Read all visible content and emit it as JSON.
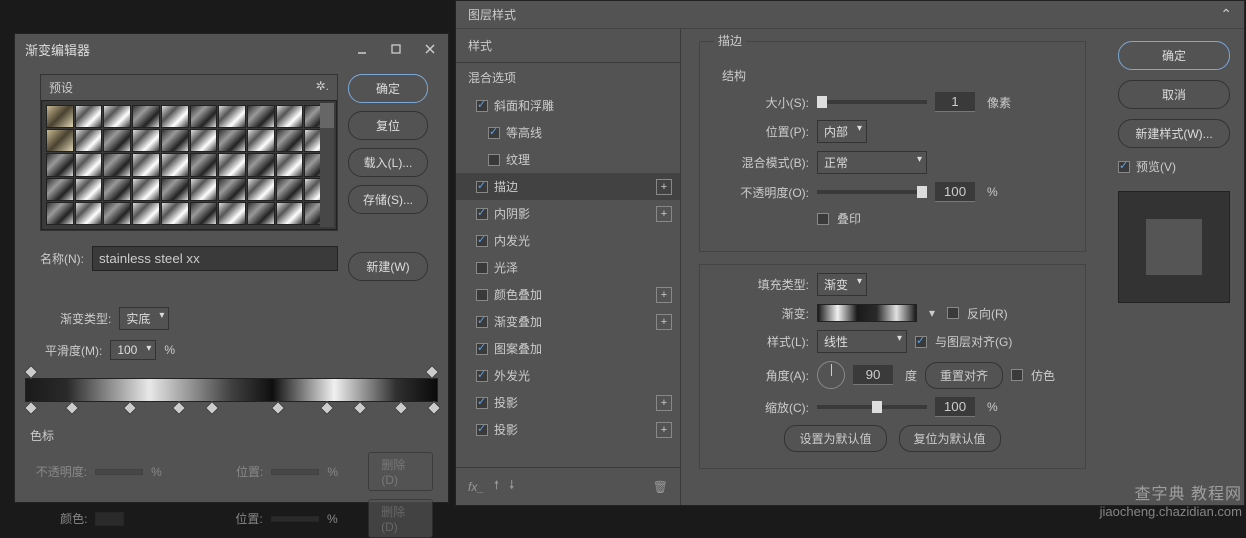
{
  "gradient_editor": {
    "title": "渐变编辑器",
    "presets_label": "预设",
    "ok": "确定",
    "reset": "复位",
    "load": "载入(L)...",
    "save": "存储(S)...",
    "new": "新建(W)",
    "name_label": "名称(N):",
    "name_value": "stainless steel xx",
    "type_label": "渐变类型:",
    "type_value": "实底",
    "smooth_label": "平滑度(M):",
    "smooth_value": "100",
    "smooth_unit": "%",
    "stops_label": "色标",
    "opacity_label": "不透明度:",
    "position_label": "位置:",
    "color_label": "颜色:",
    "delete": "删除(D)",
    "pct": "%"
  },
  "layer_style": {
    "title": "图层样式",
    "styles_header": "样式",
    "blend_header": "混合选项",
    "items": {
      "bevel": "斜面和浮雕",
      "contour": "等高线",
      "texture": "纹理",
      "stroke": "描边",
      "inner_shadow": "内阴影",
      "inner_glow": "内发光",
      "satin": "光泽",
      "color_overlay": "颜色叠加",
      "gradient_overlay": "渐变叠加",
      "pattern_overlay": "图案叠加",
      "outer_glow": "外发光",
      "drop_shadow": "投影",
      "drop_shadow2": "投影"
    },
    "stroke_panel": {
      "title": "描边",
      "structure": "结构",
      "size": "大小(S):",
      "size_val": "1",
      "size_unit": "像素",
      "position": "位置(P):",
      "position_val": "内部",
      "blend_mode": "混合模式(B):",
      "blend_mode_val": "正常",
      "opacity": "不透明度(O):",
      "opacity_val": "100",
      "opacity_unit": "%",
      "overprint": "叠印",
      "fill_type": "填充类型:",
      "fill_type_val": "渐变",
      "gradient": "渐变:",
      "reverse": "反向(R)",
      "style": "样式(L):",
      "style_val": "线性",
      "align": "与图层对齐(G)",
      "angle": "角度(A):",
      "angle_val": "90",
      "angle_unit": "度",
      "reset_align": "重置对齐",
      "dither": "仿色",
      "scale": "缩放(C):",
      "scale_val": "100",
      "scale_unit": "%",
      "set_default": "设置为默认值",
      "reset_default": "复位为默认值"
    },
    "right": {
      "ok": "确定",
      "cancel": "取消",
      "new_style": "新建样式(W)...",
      "preview": "预览(V)"
    }
  },
  "watermark": {
    "line1": "查字典 教程网",
    "line2": "jiaocheng.chazidian.com"
  }
}
